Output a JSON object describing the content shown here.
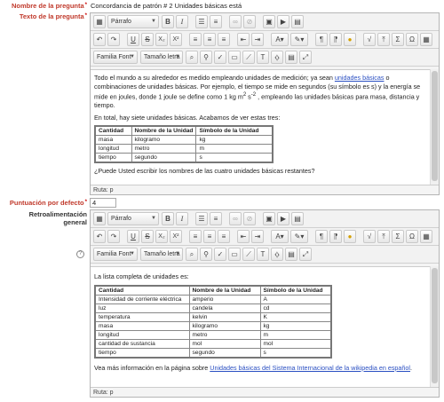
{
  "form": {
    "question_name_label": "Nombre de la pregunta",
    "question_name_value": "Concordancia de patrón # 2 Unidades básicas está",
    "question_text_label": "Texto de la pregunta",
    "default_score_label": "Puntuación por defecto",
    "default_score_value": "4",
    "feedback_label_line1": "Retroalimentación",
    "feedback_label_line2": "general",
    "required_marker": "*",
    "help_icon": "?"
  },
  "toolbar_labels": {
    "paragraph": "Párrafo",
    "font_family": "Familia Font",
    "font_size": "Tamaño letra",
    "bold": "B",
    "italic": "I",
    "underline": "U",
    "strikethrough": "S",
    "subscript": "X₂",
    "superscript": "X²",
    "font_color": "A",
    "ltr": "¶",
    "rtl": "¶",
    "omega": "Ω",
    "sqrt": "√",
    "path_label": "Ruta: p"
  },
  "editor1": {
    "para1_a": "Todo el mundo a su alrededor es medido empleando unidades de medición; ya sean ",
    "para1_link": "unidades básicas",
    "para1_b": " o combinaciones de unidades básicas. Por ejemplo, el tiempo se mide en segundos (su símbolo es s) y la energía se mide en joules, donde 1 joule se define como 1 kg m",
    "para1_sup1": "2",
    "para1_c": " s",
    "para1_sup2": "-2",
    "para1_d": " , empleando las unidades básicas para masa, distancia y tiempo.",
    "para2": "En total, hay siete unidades básicas. Acabamos de ver estas tres:",
    "table_headers": [
      "Cantidad",
      "Nombre de la Unidad",
      "Símbolo de la Unidad"
    ],
    "table_rows": [
      [
        "masa",
        "kilogramo",
        "kg"
      ],
      [
        "longitud",
        "metro",
        "m"
      ],
      [
        "tiempo",
        "segundo",
        "s"
      ]
    ],
    "para3": "¿Puede Usted escribir los nombres de las cuatro unidades básicas restantes?"
  },
  "editor2": {
    "para1": "La lista completa de unidades es:",
    "table_headers": [
      "Cantidad",
      "Nombre de la Unidad",
      "Símbolo de la Unidad"
    ],
    "table_rows": [
      [
        "Intensidad de corriente eléctrica",
        "amperio",
        "A"
      ],
      [
        "luz",
        "candela",
        "cd"
      ],
      [
        "temperatura",
        "kelvin",
        "K"
      ],
      [
        "masa",
        "kilogramo",
        "kg"
      ],
      [
        "longitud",
        "metro",
        "m"
      ],
      [
        "cantidad de sustancia",
        "mol",
        "mol"
      ],
      [
        "tiempo",
        "segundo",
        "s"
      ]
    ],
    "para2_a": "Vea más información en la página sobre ",
    "para2_link": "Unidades básicas del Sistema Internacional de la wikipedia en español",
    "para2_b": "."
  },
  "colors": {
    "label_red": "#c0392b",
    "link_blue": "#2a4fc2"
  }
}
